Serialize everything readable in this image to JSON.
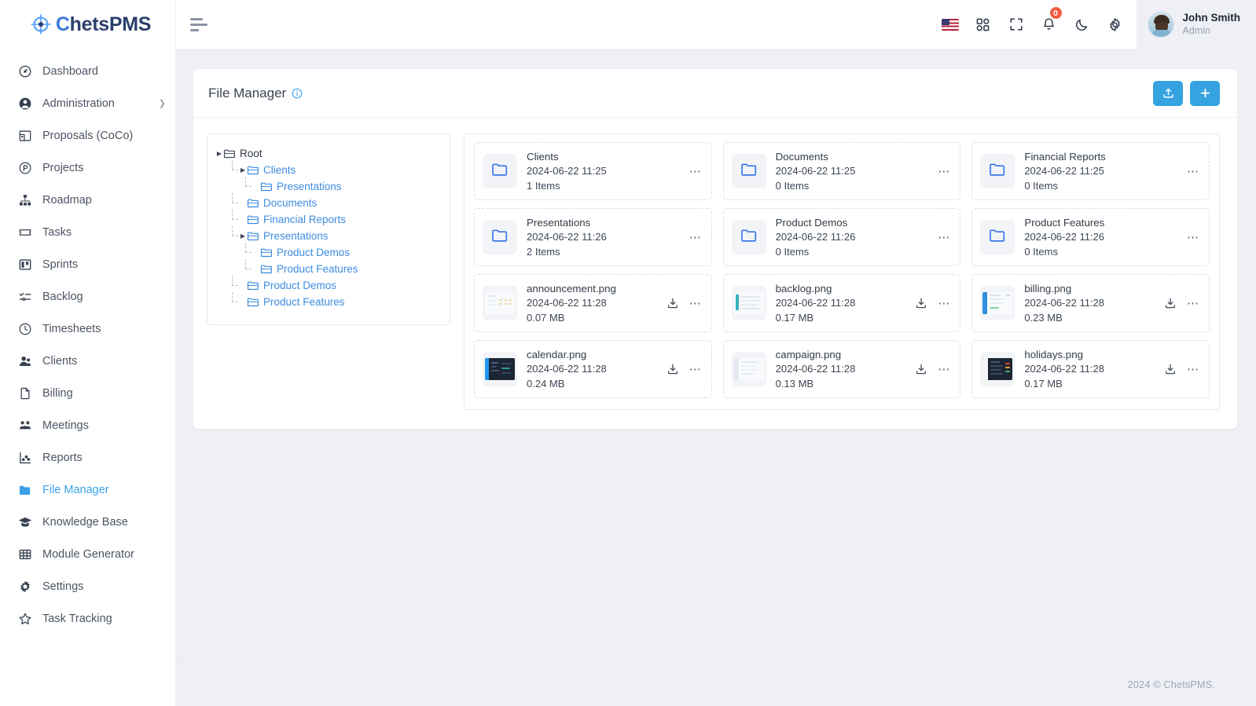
{
  "brand": {
    "prefix": "C",
    "name_rest": "hetsPMS",
    "full": "ChetsPMS"
  },
  "sidebar": {
    "items": [
      {
        "label": "Dashboard",
        "icon": "speedometer-icon",
        "active": false,
        "caret": false
      },
      {
        "label": "Administration",
        "icon": "user-circle-icon",
        "active": false,
        "caret": true
      },
      {
        "label": "Proposals (CoCo)",
        "icon": "layout-icon",
        "active": false,
        "caret": false
      },
      {
        "label": "Projects",
        "icon": "p-circle-icon",
        "active": false,
        "caret": false
      },
      {
        "label": "Roadmap",
        "icon": "sitemap-icon",
        "active": false,
        "caret": false
      },
      {
        "label": "Tasks",
        "icon": "ticket-icon",
        "active": false,
        "caret": false
      },
      {
        "label": "Sprints",
        "icon": "board-icon",
        "active": false,
        "caret": false
      },
      {
        "label": "Backlog",
        "icon": "list-check-icon",
        "active": false,
        "caret": false
      },
      {
        "label": "Timesheets",
        "icon": "clock-icon",
        "active": false,
        "caret": false
      },
      {
        "label": "Clients",
        "icon": "users-icon",
        "active": false,
        "caret": false
      },
      {
        "label": "Billing",
        "icon": "file-icon",
        "active": false,
        "caret": false
      },
      {
        "label": "Meetings",
        "icon": "people-group-icon",
        "active": false,
        "caret": false
      },
      {
        "label": "Reports",
        "icon": "chart-scatter-icon",
        "active": false,
        "caret": false
      },
      {
        "label": "File Manager",
        "icon": "folder-icon",
        "active": true,
        "caret": false
      },
      {
        "label": "Knowledge Base",
        "icon": "graduation-cap-icon",
        "active": false,
        "caret": false
      },
      {
        "label": "Module Generator",
        "icon": "grid-table-icon",
        "active": false,
        "caret": false
      },
      {
        "label": "Settings",
        "icon": "gear-icon",
        "active": false,
        "caret": false
      },
      {
        "label": "Task Tracking",
        "icon": "star-icon",
        "active": false,
        "caret": false
      }
    ]
  },
  "topbar": {
    "menu_toggle": "hamburger-icon",
    "icons": [
      "us-flag-icon",
      "apps-grid-icon",
      "fullscreen-icon",
      "bell-icon",
      "moon-icon",
      "gear-icon"
    ],
    "notification_count": "0",
    "user": {
      "name": "John Smith",
      "role": "Admin"
    }
  },
  "page": {
    "title": "File Manager",
    "info_icon": "info-circle-icon",
    "actions": [
      {
        "name": "upload-button",
        "icon": "upload-icon"
      },
      {
        "name": "add-button",
        "icon": "plus-icon"
      }
    ]
  },
  "tree": [
    {
      "label": "Root",
      "depth": 0,
      "caret": "collapsed",
      "root": true
    },
    {
      "label": "Clients",
      "depth": 1,
      "caret": "collapsed",
      "root": false
    },
    {
      "label": "Presentations",
      "depth": 2,
      "caret": "none",
      "root": false
    },
    {
      "label": "Documents",
      "depth": 1,
      "caret": "none",
      "root": false
    },
    {
      "label": "Financial Reports",
      "depth": 1,
      "caret": "none",
      "root": false
    },
    {
      "label": "Presentations",
      "depth": 1,
      "caret": "collapsed",
      "root": false
    },
    {
      "label": "Product Demos",
      "depth": 2,
      "caret": "none",
      "root": false
    },
    {
      "label": "Product Features",
      "depth": 2,
      "caret": "none",
      "root": false
    },
    {
      "label": "Product Demos",
      "depth": 1,
      "caret": "none",
      "root": false
    },
    {
      "label": "Product Features",
      "depth": 1,
      "caret": "none",
      "root": false
    }
  ],
  "files": [
    {
      "name": "Clients",
      "date": "2024-06-22 11:25",
      "sub": "1 Items",
      "type": "folder"
    },
    {
      "name": "Documents",
      "date": "2024-06-22 11:25",
      "sub": "0 Items",
      "type": "folder"
    },
    {
      "name": "Financial Reports",
      "date": "2024-06-22 11:25",
      "sub": "0 Items",
      "type": "folder"
    },
    {
      "name": "Presentations",
      "date": "2024-06-22 11:26",
      "sub": "2 Items",
      "type": "folder"
    },
    {
      "name": "Product Demos",
      "date": "2024-06-22 11:26",
      "sub": "0 Items",
      "type": "folder"
    },
    {
      "name": "Product Features",
      "date": "2024-06-22 11:26",
      "sub": "0 Items",
      "type": "folder"
    },
    {
      "name": "announcement.png",
      "date": "2024-06-22 11:28",
      "sub": "0.07 MB",
      "type": "image",
      "thumb": "light-doc"
    },
    {
      "name": "backlog.png",
      "date": "2024-06-22 11:28",
      "sub": "0.17 MB",
      "type": "image",
      "thumb": "light-teal"
    },
    {
      "name": "billing.png",
      "date": "2024-06-22 11:28",
      "sub": "0.23 MB",
      "type": "image",
      "thumb": "light-blue"
    },
    {
      "name": "calendar.png",
      "date": "2024-06-22 11:28",
      "sub": "0.24 MB",
      "type": "image",
      "thumb": "dark-blue"
    },
    {
      "name": "campaign.png",
      "date": "2024-06-22 11:28",
      "sub": "0.13 MB",
      "type": "image",
      "thumb": "light-grey"
    },
    {
      "name": "holidays.png",
      "date": "2024-06-22 11:28",
      "sub": "0.17 MB",
      "type": "image",
      "thumb": "dark-list"
    }
  ],
  "file_actions": {
    "download": "download-icon",
    "more": "more-options-icon"
  },
  "footer": {
    "text": "2024 © ChetsPMS."
  },
  "colors": {
    "accent": "#35a3e0",
    "link": "#3c8ce0",
    "badge": "#f05a3f",
    "folder": "#3a77ea"
  }
}
